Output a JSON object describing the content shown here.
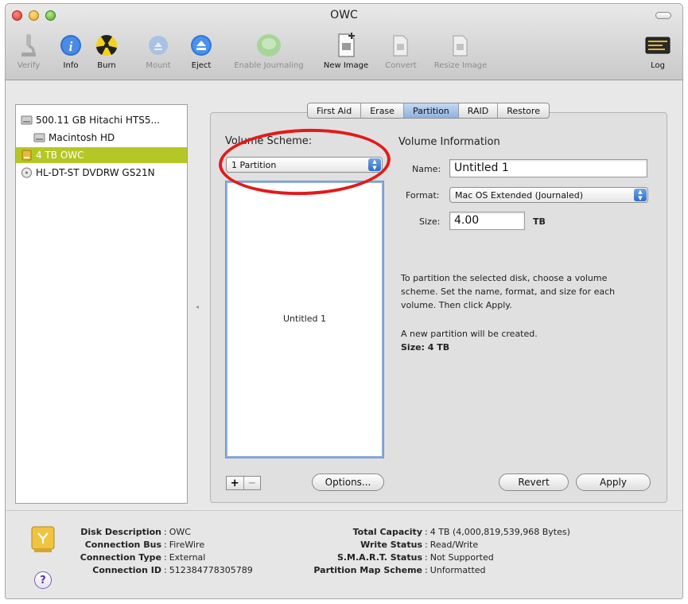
{
  "window": {
    "title": "OWC"
  },
  "toolbar": {
    "items": [
      {
        "label": "Verify",
        "icon": "microscope-icon",
        "enabled": false
      },
      {
        "label": "Info",
        "icon": "info-icon",
        "enabled": true
      },
      {
        "label": "Burn",
        "icon": "burn-icon",
        "enabled": true
      },
      {
        "label": "Mount",
        "icon": "mount-icon",
        "enabled": false
      },
      {
        "label": "Eject",
        "icon": "eject-icon",
        "enabled": true
      },
      {
        "label": "Enable Journaling",
        "icon": "journaling-icon",
        "enabled": false
      },
      {
        "label": "New Image",
        "icon": "new-image-icon",
        "enabled": true
      },
      {
        "label": "Convert",
        "icon": "convert-icon",
        "enabled": false
      },
      {
        "label": "Resize Image",
        "icon": "resize-image-icon",
        "enabled": false
      }
    ],
    "log_label": "Log"
  },
  "sidebar": {
    "items": [
      {
        "label": "500.11 GB Hitachi HTS5...",
        "icon": "hard-drive-icon",
        "selected": false
      },
      {
        "label": "Macintosh HD",
        "icon": "volume-icon",
        "selected": false
      },
      {
        "label": "4 TB OWC",
        "icon": "external-drive-icon",
        "selected": true
      },
      {
        "label": "HL-DT-ST DVDRW GS21N",
        "icon": "optical-drive-icon",
        "selected": false
      }
    ]
  },
  "tabs": [
    {
      "label": "First Aid",
      "active": false
    },
    {
      "label": "Erase",
      "active": false
    },
    {
      "label": "Partition",
      "active": true
    },
    {
      "label": "RAID",
      "active": false
    },
    {
      "label": "Restore",
      "active": false
    }
  ],
  "partition": {
    "volume_scheme_label": "Volume Scheme:",
    "volume_scheme_value": "1 Partition",
    "volume_info_label": "Volume Information",
    "name_label": "Name:",
    "name_value": "Untitled 1",
    "format_label": "Format:",
    "format_value": "Mac OS Extended (Journaled)",
    "size_label": "Size:",
    "size_value": "4.00",
    "size_unit": "TB",
    "diagram_volume_label": "Untitled 1",
    "instructions_line1": "To partition the selected disk, choose a volume",
    "instructions_line2": "scheme. Set the name, format, and size for each",
    "instructions_line3": "volume. Then click Apply.",
    "status_line1": "A new partition will be created.",
    "status_line2": "Size: 4 TB",
    "plus_label": "+",
    "minus_label": "−",
    "options_label": "Options...",
    "revert_label": "Revert",
    "apply_label": "Apply"
  },
  "disk_info": {
    "left": [
      {
        "key": "Disk Description",
        "value": "OWC"
      },
      {
        "key": "Connection Bus",
        "value": "FireWire"
      },
      {
        "key": "Connection Type",
        "value": "External"
      },
      {
        "key": "Connection ID",
        "value": "512384778305789"
      }
    ],
    "right": [
      {
        "key": "Total Capacity",
        "value": "4 TB (4,000,819,539,968 Bytes)"
      },
      {
        "key": "Write Status",
        "value": "Read/Write"
      },
      {
        "key": "S.M.A.R.T. Status",
        "value": "Not Supported"
      },
      {
        "key": "Partition Map Scheme",
        "value": "Unformatted"
      }
    ],
    "help_label": "?"
  },
  "colors": {
    "selection": "#b5c726",
    "highlight_circle": "#e31a1a",
    "active_tab": "#8eb2e0"
  }
}
